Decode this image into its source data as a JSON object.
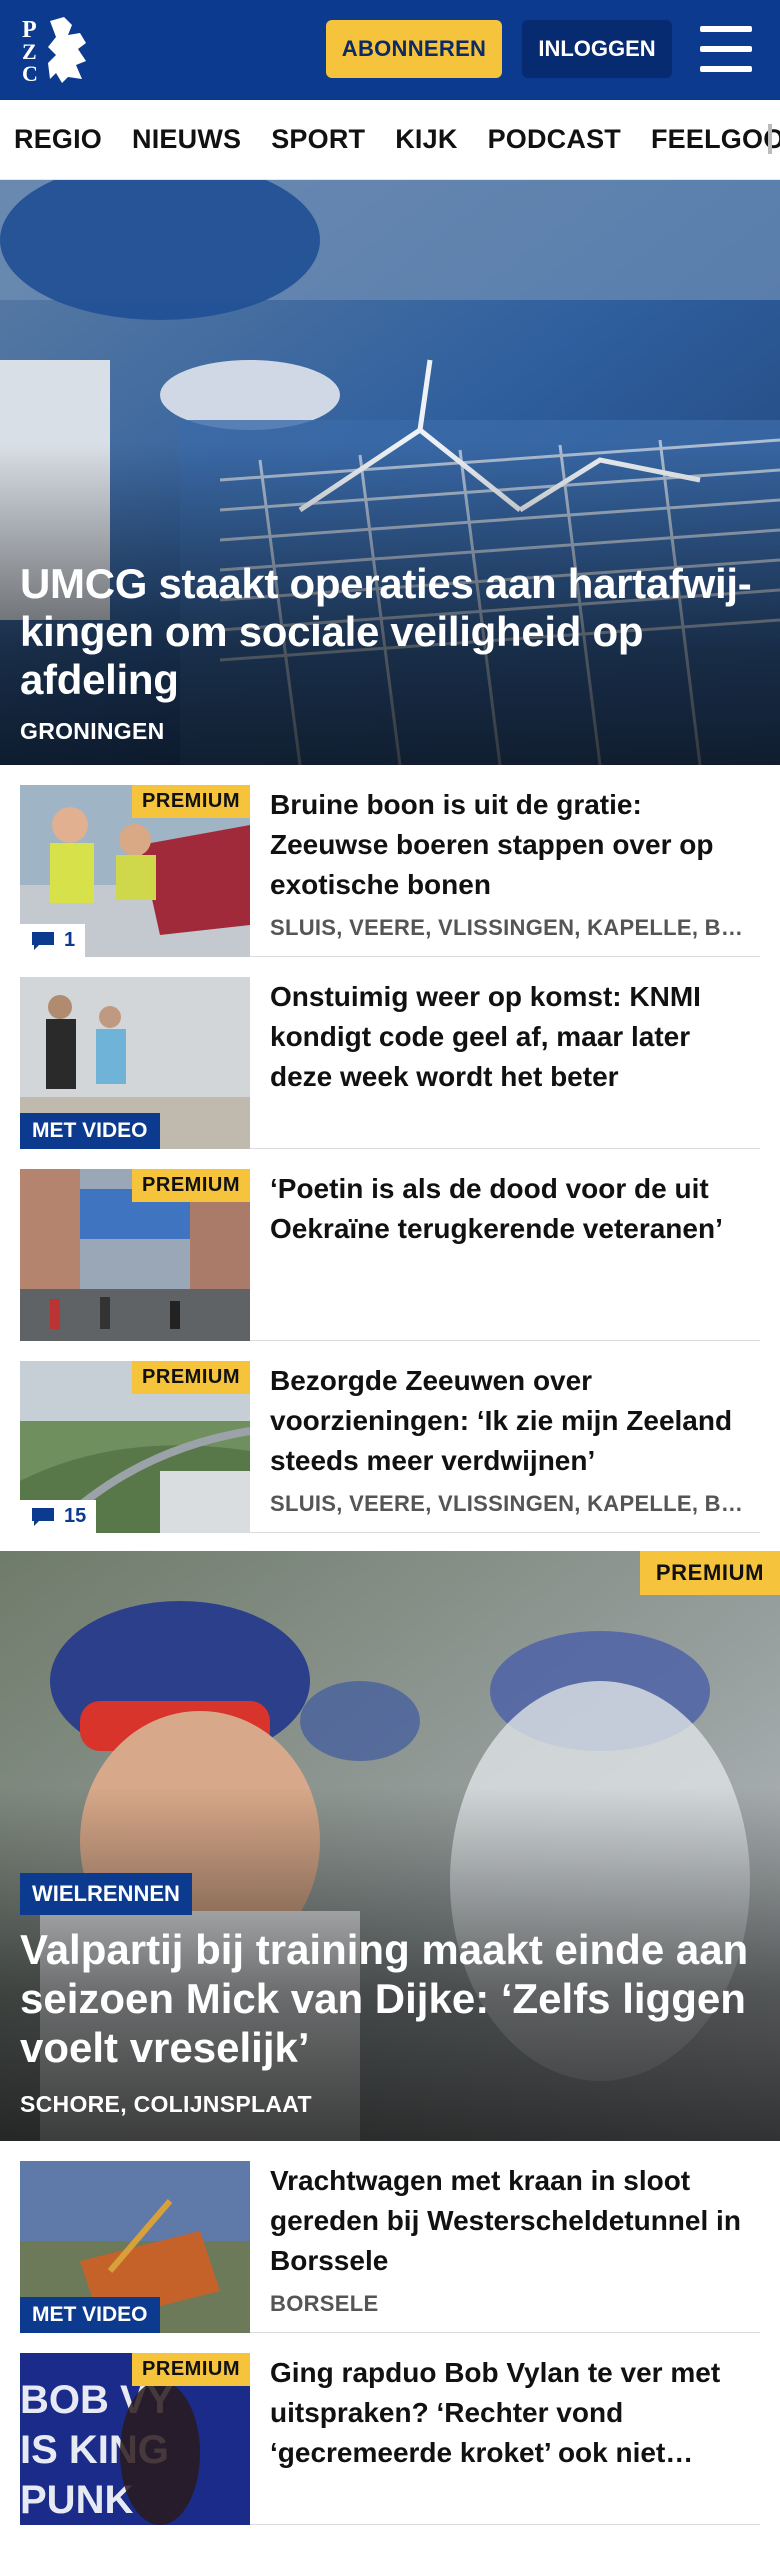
{
  "header": {
    "logo_text": "PZC",
    "subscribe_label": "ABONNEREN",
    "login_label": "INLOGGEN",
    "menu_icon": "hamburger-icon",
    "colors": {
      "brand": "#0b3a8f",
      "accent": "#f6c33c"
    }
  },
  "nav": {
    "items": [
      "REGIO",
      "NIEUWS",
      "SPORT",
      "KIJK",
      "PODCAST",
      "FEELGOOD"
    ]
  },
  "hero": {
    "title": "UMCG staakt operaties aan hartafwij­kingen om sociale veiligheid op afdeling",
    "location": "GRONINGEN"
  },
  "articles": [
    {
      "title": "Bruine boon is uit de gratie: Zeeuwse boeren stappen over op exotische bonen",
      "location": "SLUIS, VEERE, VLISSINGEN, KAPELLE, BORSELE",
      "premium": "PREMIUM",
      "comments": "1"
    },
    {
      "title": "Onstuimig weer op komst: KNMI kondigt code geel af, maar later deze week wordt het beter",
      "video": "MET VIDEO"
    },
    {
      "title": "‘Poetin is als de dood voor de uit Oekraïne terugkerende veteranen’",
      "premium": "PREMIUM"
    },
    {
      "title": "Bezorgde Zeeuwen over voorzieningen: ‘Ik zie mijn Zeeland steeds meer verdwijnen’",
      "location": "SLUIS, VEERE, VLISSINGEN, KAPELLE, BORSELE",
      "premium": "PREMIUM",
      "comments": "15"
    }
  ],
  "feature": {
    "premium": "PREMIUM",
    "category": "WIELRENNEN",
    "title": "Valpartij bij training maakt einde aan seizoen Mick van Dijke: ‘Zelfs liggen voelt vreselijk’",
    "location": "SCHORE, COLIJNSPLAAT"
  },
  "articles2": [
    {
      "title": "Vrachtwagen met kraan in sloot gereden bij Westerscheldetunnel in Borssele",
      "location": "BORSELE",
      "video": "MET VIDEO"
    },
    {
      "title": "Ging rapduo Bob Vylan te ver met uitspraken? ‘Rechter vond ‘gecremeerde kroket’ ook niet…",
      "premium": "PREMIUM"
    }
  ]
}
